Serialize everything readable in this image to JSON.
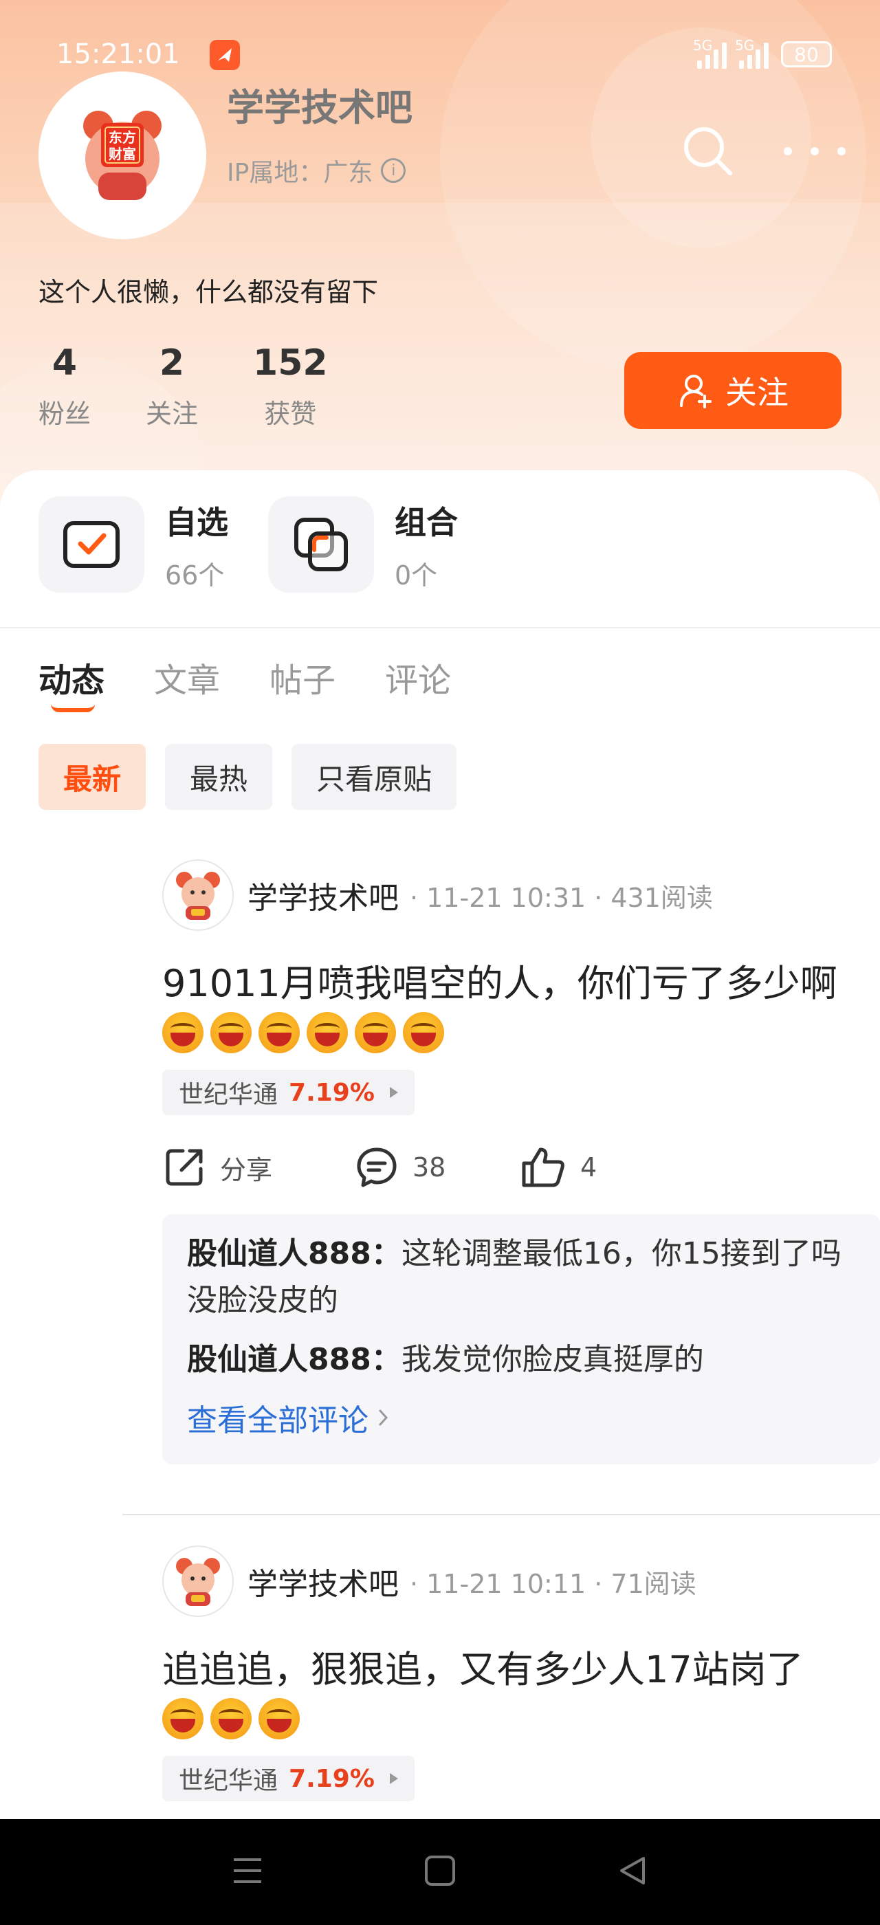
{
  "status_bar": {
    "time": "15:21:01",
    "signal1_label": "5G",
    "signal2_label": "5G",
    "battery": "80"
  },
  "profile": {
    "name": "学学技术吧",
    "ip_location": "IP属地：广东",
    "bio": "这个人很懒，什么都没有留下",
    "avatar_logo_text": "东方财富",
    "stats": [
      {
        "value": "4",
        "label": "粉丝"
      },
      {
        "value": "2",
        "label": "关注"
      },
      {
        "value": "152",
        "label": "获赞"
      }
    ],
    "follow_label": "关注"
  },
  "shortcuts": [
    {
      "title": "自选",
      "count": "66个",
      "icon": "checkbox-icon"
    },
    {
      "title": "组合",
      "count": "0个",
      "icon": "overlap-squares-icon"
    }
  ],
  "tabs": [
    "动态",
    "文章",
    "帖子",
    "评论"
  ],
  "active_tab": "动态",
  "filters": [
    "最新",
    "最热",
    "只看原贴"
  ],
  "active_filter": "最新",
  "colors": {
    "accent": "#ff5b14",
    "stock_up": "#e8401c",
    "link": "#2b6fd6"
  },
  "posts": [
    {
      "author": "学学技术吧",
      "meta": "· 11-21 10:31 · 431阅读",
      "text": "91011月喷我唱空的人，你们亏了多少啊",
      "emoji_count": 6,
      "stock_name": "世纪华通",
      "stock_change": "7.19%",
      "share_label": "分享",
      "comment_count": "38",
      "like_count": "4",
      "comments": [
        {
          "user": "股仙道人888：",
          "text": "这轮调整最低16，你15接到了吗",
          "continuation": "没脸没皮的"
        },
        {
          "user": "股仙道人888：",
          "text": "我发觉你脸皮真挺厚的",
          "continuation": ""
        }
      ],
      "see_all_label": "查看全部评论"
    },
    {
      "author": "学学技术吧",
      "meta": "· 11-21 10:11 · 71阅读",
      "text": "追追追，狠狠追，又有多少人17站岗了",
      "emoji_count": 3,
      "stock_name": "世纪华通",
      "stock_change": "7.19%"
    }
  ]
}
